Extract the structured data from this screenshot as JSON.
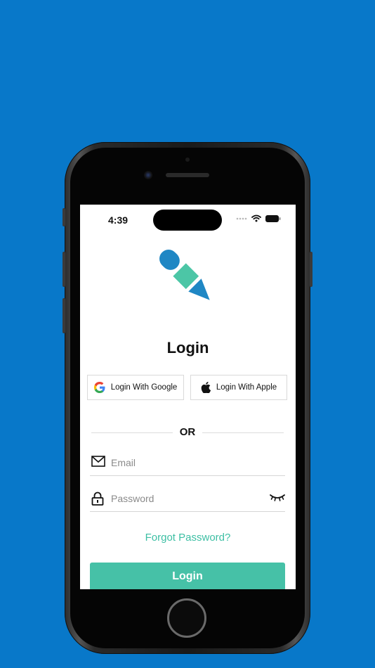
{
  "colors": {
    "background": "#0878c9",
    "accent": "#46c1a7",
    "link": "#3dbfa4",
    "logo_blue": "#1f87c4",
    "logo_teal": "#4cc6a6"
  },
  "status_bar": {
    "time": "4:39",
    "icons": [
      "signal-dots-icon",
      "wifi-icon",
      "battery-icon"
    ]
  },
  "login": {
    "title": "Login",
    "google_label": "Login With Google",
    "apple_label": "Login With Apple",
    "or_label": "OR",
    "email_placeholder": "Email",
    "password_placeholder": "Password",
    "forgot_label": "Forgot Password?",
    "login_button_label": "Login"
  },
  "icons": {
    "logo": "pencil-logo-icon",
    "google": "google-icon",
    "apple": "apple-icon",
    "email": "mail-icon",
    "password": "lock-icon",
    "visibility": "eye-closed-icon"
  }
}
